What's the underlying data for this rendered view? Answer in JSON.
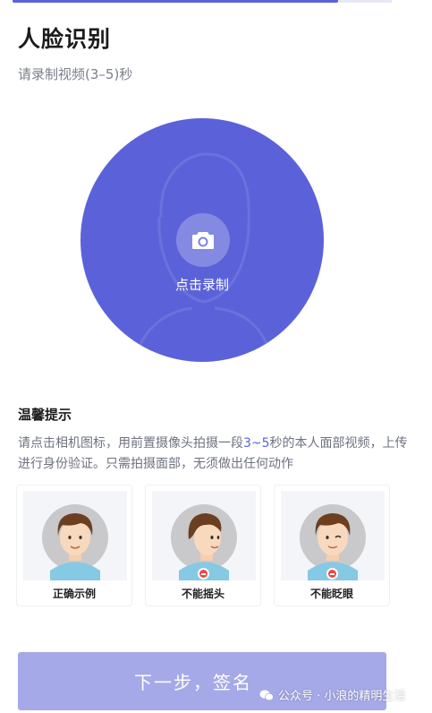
{
  "header": {
    "title": "人脸识别",
    "subtitle": "请录制视频(3–5)秒"
  },
  "recorder": {
    "label": "点击录制"
  },
  "tips": {
    "title": "温馨提示",
    "text_before": "请点击相机图标，用前置摄像头拍摄一段",
    "text_highlight": "3~5",
    "text_after": "秒的本人面部视频，上传进行身份验证。只需拍摄面部，无须做出任何动作"
  },
  "examples": [
    {
      "caption": "正确示例"
    },
    {
      "caption": "不能摇头"
    },
    {
      "caption": "不能眨眼"
    }
  ],
  "footer": {
    "next_label": "下一步，签名"
  },
  "watermark": {
    "text": "公众号 · 小浪的精明生活"
  },
  "colors": {
    "accent": "#5b62d9",
    "button_disabled": "#a6a9e8",
    "error": "#ea4a45"
  }
}
